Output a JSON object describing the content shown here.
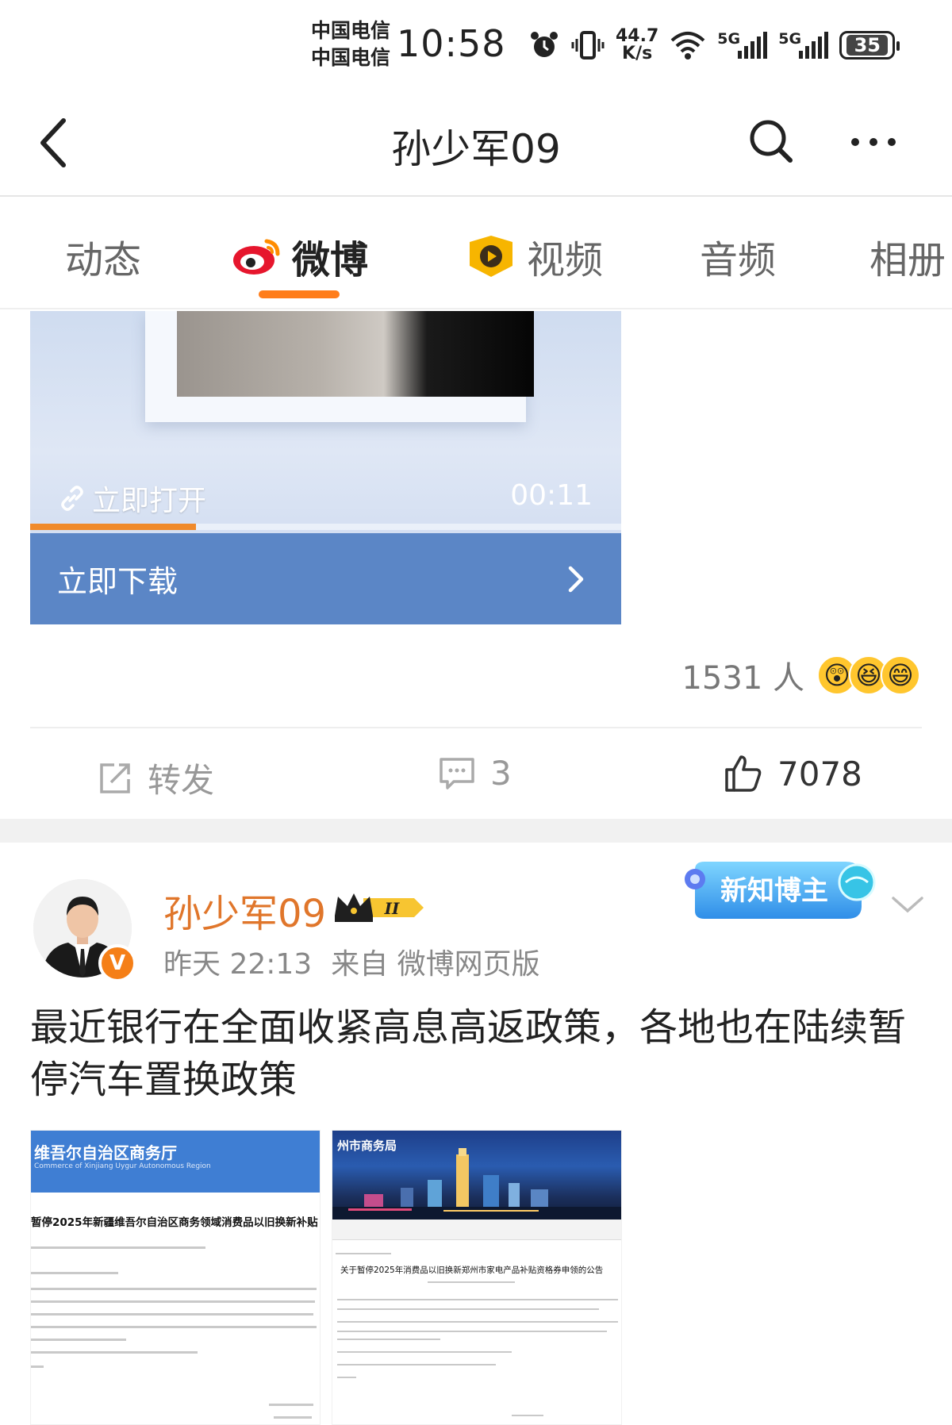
{
  "status_bar": {
    "carrier_1": "中国电信",
    "carrier_2": "中国电信",
    "time": "10:58",
    "net_speed_value": "44.7",
    "net_speed_unit": "K/s",
    "signal_1": "5G",
    "signal_2": "5G",
    "battery": "35"
  },
  "nav": {
    "title": "孙少军09",
    "back_icon": "chevron-left-icon",
    "search_icon": "search-icon",
    "more_icon": "more-icon"
  },
  "tabs": [
    {
      "label": "动态",
      "active": false
    },
    {
      "label": "微博",
      "active": true
    },
    {
      "label": "视频",
      "active": false
    },
    {
      "label": "音频",
      "active": false
    },
    {
      "label": "相册",
      "active": false
    }
  ],
  "accent_color": "#ff7d1a",
  "video_card": {
    "open_label": "立即打开",
    "duration": "00:11",
    "progress_fraction": 0.28,
    "download_label": "立即下载"
  },
  "reactions": {
    "count_text": "1531 人",
    "emojis": [
      "😲",
      "😆",
      "😄"
    ]
  },
  "actions": {
    "repost_label": "转发",
    "comment_count": "3",
    "like_count": "7078"
  },
  "post": {
    "author": "孙少军09",
    "vip_level": "II",
    "verified_mark": "V",
    "time": "昨天 22:13",
    "source": "来自 微博网页版",
    "badge_text": "新知博主",
    "text": "最近银行在全面收紧高息高返政策，各地也在陆续暂停汽车置换政策",
    "images": [
      {
        "org_name": "维吾尔自治区商务厅",
        "org_sub": "Commerce of Xinjiang Uygur Autonomous Region",
        "headline": "暂停2025年新疆维吾尔自治区商务领域消费品以旧换新补贴"
      },
      {
        "org_name": "州市商务局",
        "headline": "关于暂停2025年消费品以旧换新郑州市家电产品补贴资格券申领的公告"
      }
    ]
  }
}
